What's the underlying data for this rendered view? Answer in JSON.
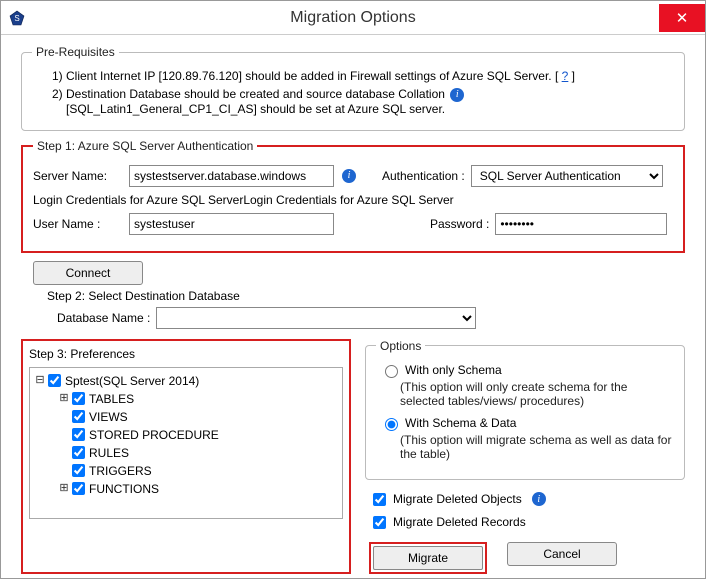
{
  "window": {
    "title": "Migration Options",
    "close_glyph": "✕"
  },
  "prereq": {
    "legend": "Pre-Requisites",
    "line1_a": "1) Client Internet IP [120.89.76.120] should be added in Firewall settings of Azure SQL Server. [ ",
    "line1_link": "?",
    "line1_b": " ]",
    "line2_a": "2) Destination Database should be created and source database Collation ",
    "line2_b": "[SQL_Latin1_General_CP1_CI_AS] should be set at Azure SQL server."
  },
  "step1": {
    "legend": "Step 1: Azure SQL Server Authentication",
    "server_label": "Server Name:",
    "server_value": "systestserver.database.windows",
    "auth_label": "Authentication :",
    "auth_value": "SQL Server Authentication",
    "login_text": "Login Credentials for Azure SQL ServerLogin Credentials for Azure SQL Server",
    "user_label": "User Name :",
    "user_value": "systestuser",
    "pass_label": "Password :",
    "pass_value": "••••••••"
  },
  "connect_label": "Connect",
  "step2": {
    "title": "Step 2: Select Destination Database",
    "db_label": "Database Name :",
    "db_value": ""
  },
  "step3": {
    "title": "Step 3: Preferences",
    "root": "Sptest(SQL Server 2014)",
    "nodes": {
      "tables": "TABLES",
      "views": "VIEWS",
      "sp": "STORED PROCEDURE",
      "rules": "RULES",
      "triggers": "TRIGGERS",
      "functions": "FUNCTIONS"
    }
  },
  "options": {
    "legend": "Options",
    "schema_only_label": "With only Schema",
    "schema_only_desc": "(This option will only create schema for the  selected tables/views/ procedures)",
    "schema_data_label": "With Schema & Data",
    "schema_data_desc": "(This option will migrate schema as well as data for the table)",
    "del_obj": "Migrate Deleted Objects",
    "del_rec": "Migrate Deleted Records"
  },
  "footer": {
    "migrate": "Migrate",
    "cancel": "Cancel"
  },
  "info_glyph": "i"
}
